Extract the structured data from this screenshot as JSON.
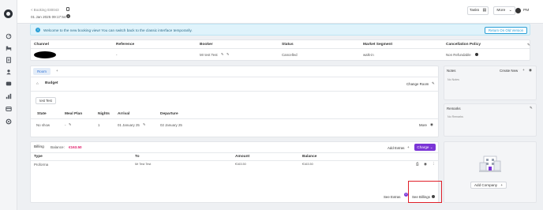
{
  "header": {
    "breadcrumb": "< Booking 030043",
    "datetime": "01 Jan 2025 09:17:54",
    "tasks_label": "Tasks",
    "more_label": "More",
    "user_initials": "PM"
  },
  "banner": {
    "text": "Welcome to the new booking view! You can switch back to the classic interface temporarily.",
    "return_label": "Return On Old Version"
  },
  "booking_table": {
    "headers": [
      "Channel",
      "Reference",
      "Booker",
      "Status",
      "Market Segment",
      "Cancellation Policy"
    ],
    "row": {
      "channel": "",
      "reference": "-",
      "booker": "Mr test Test",
      "status": "Cancelled",
      "market_segment": "walk-in",
      "cancellation_policy": "Non Refundable"
    }
  },
  "room_panel": {
    "tab_room": "Room",
    "tab_add": "+",
    "room_type": "Budget",
    "change_room_label": "Change Room",
    "guest_chip": "test Test",
    "headers": [
      "State",
      "Meal Plan",
      "Nights",
      "Arrival",
      "Departure"
    ],
    "row": {
      "state": "No show",
      "meal_plan": "-",
      "nights": "1",
      "arrival": "01 January 25",
      "departure": "02 January 25"
    },
    "more_label": "More"
  },
  "billing": {
    "title": "Billing",
    "balance_label": "Balance:",
    "balance_value": "€163.50",
    "add_extras_label": "Add Extras",
    "charge_label": "Charge",
    "headers": [
      "Type",
      "To",
      "Amount",
      "Balance"
    ],
    "row": {
      "type": "Proforma",
      "to": "Mr Test Test",
      "amount": "€163.50",
      "balance": "€163.50"
    },
    "see_extras_label": "See Extras",
    "see_billings_label": "See Billings",
    "extras_badge": "0"
  },
  "notes": {
    "title": "Notes",
    "create_new_label": "Create New",
    "placeholder": "No Notes"
  },
  "remarks": {
    "title": "Remarks",
    "placeholder": "No Remarks"
  },
  "company": {
    "add_company_label": "Add Company",
    "add_symbol": "+"
  },
  "colors": {
    "accent_blue": "#2a9fd6",
    "balance_pink": "#e0206d",
    "charge_purple": "#7b35d6",
    "highlight_red": "#e0202a"
  }
}
